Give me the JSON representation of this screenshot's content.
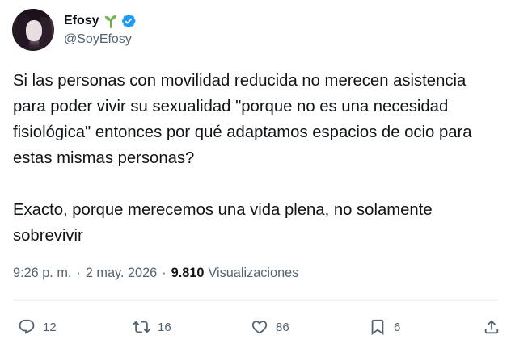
{
  "author": {
    "display_name": "Efosy",
    "handle": "@SoyEfosy",
    "name_emoji": "sprout",
    "verified": true,
    "verified_color": "#1d9bf0"
  },
  "tweet": {
    "text": "Si las personas con movilidad reducida no merecen asistencia para poder vivir su sexualidad \"porque no es una necesidad fisiológica\" entonces por qué adaptamos espacios de ocio para estas mismas personas?\n\nExacto, porque merecemos una vida plena, no solamente sobrevivir"
  },
  "meta": {
    "time": "9:26 p. m.",
    "separator": "·",
    "date": "2 may. 2026",
    "views_count": "9.810",
    "views_label": "Visualizaciones"
  },
  "actions": {
    "reply": {
      "icon": "reply-icon",
      "count": "12"
    },
    "retweet": {
      "icon": "retweet-icon",
      "count": "16"
    },
    "like": {
      "icon": "heart-icon",
      "count": "86"
    },
    "bookmark": {
      "icon": "bookmark-icon",
      "count": "6"
    },
    "share": {
      "icon": "share-icon"
    }
  },
  "colors": {
    "text": "#0f1419",
    "secondary": "#536471",
    "divider": "#eff3f4"
  }
}
